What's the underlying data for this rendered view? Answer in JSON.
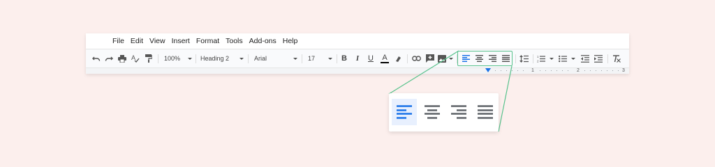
{
  "menu": {
    "items": [
      "File",
      "Edit",
      "View",
      "Insert",
      "Format",
      "Tools",
      "Add-ons",
      "Help"
    ]
  },
  "toolbar": {
    "zoom_value": "100%",
    "style_value": "Heading 2",
    "font_value": "Arial",
    "size_value": "17",
    "bold_label": "B",
    "italic_label": "I",
    "underline_label": "U",
    "text_color_label": "A",
    "text_color": "#000000",
    "active_alignment": "left",
    "icons": [
      "undo-icon",
      "redo-icon",
      "print-icon",
      "spellcheck-icon",
      "paint-format-icon",
      "link-icon",
      "comment-icon",
      "image-icon",
      "align-left-icon",
      "align-center-icon",
      "align-right-icon",
      "align-justify-icon",
      "line-spacing-icon",
      "numbered-list-icon",
      "bulleted-list-icon",
      "decrease-indent-icon",
      "increase-indent-icon",
      "clear-formatting-icon"
    ]
  },
  "ruler": {
    "numbers": [
      "1",
      "2",
      "3"
    ]
  },
  "zoom_panel": {
    "active_alignment": "left",
    "accent_color": "#1a73e8",
    "highlight_color": "#58c28c"
  }
}
